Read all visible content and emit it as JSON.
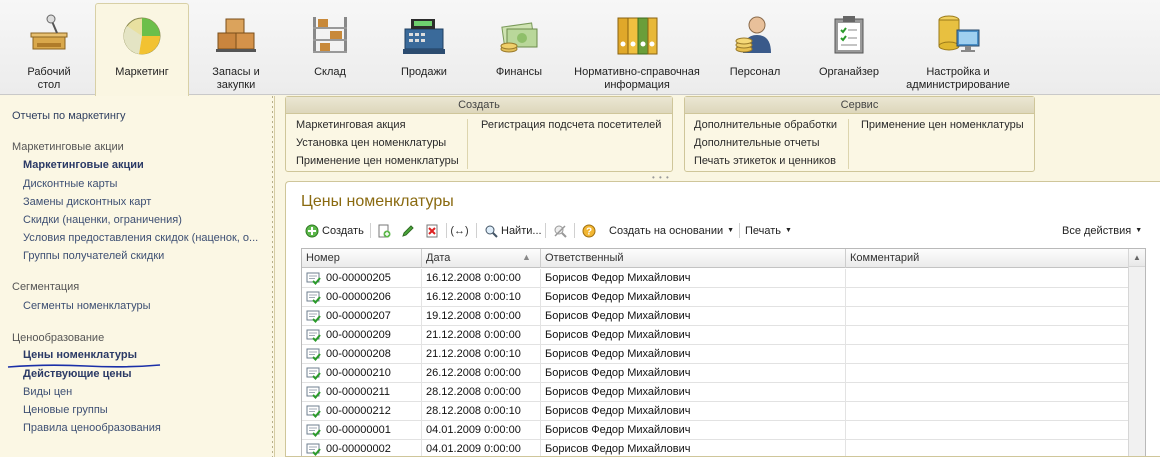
{
  "sections": [
    {
      "label": "Рабочий стол",
      "icon": "desk-icon"
    },
    {
      "label": "Маркетинг",
      "icon": "pie-chart-icon",
      "active": true
    },
    {
      "label": "Запасы и закупки",
      "icon": "boxes-icon"
    },
    {
      "label": "Склад",
      "icon": "warehouse-shelf-icon"
    },
    {
      "label": "Продажи",
      "icon": "cash-register-icon"
    },
    {
      "label": "Финансы",
      "icon": "money-icon"
    },
    {
      "label": "Нормативно-справочная информация",
      "icon": "binders-icon"
    },
    {
      "label": "Персонал",
      "icon": "person-icon"
    },
    {
      "label": "Органайзер",
      "icon": "clipboard-icon"
    },
    {
      "label": "Настройка и администрирование",
      "icon": "database-monitor-icon"
    }
  ],
  "leftnav": {
    "reports": "Отчеты по маркетингу",
    "group1": "Маркетинговые акции",
    "group1_items": [
      "Маркетинговые акции",
      "Дисконтные карты",
      "Замены дисконтных карт",
      "Скидки (наценки, ограничения)",
      "Условия предоставления скидок (наценок, о...",
      "Группы получателей скидки"
    ],
    "group2": "Сегментация",
    "group2_items": [
      "Сегменты номенклатуры"
    ],
    "group3": "Ценообразование",
    "group3_items": [
      "Цены номенклатуры",
      "Действующие цены",
      "Виды цен",
      "Ценовые группы",
      "Правила ценообразования"
    ]
  },
  "create_panel": {
    "title": "Создать",
    "links": [
      "Маркетинговая акция",
      "Установка цен номенклатуры",
      "Применение цен номенклатуры",
      "Регистрация подсчета посетителей"
    ]
  },
  "service_panel": {
    "title": "Сервис",
    "links": [
      "Дополнительные обработки",
      "Дополнительные отчеты",
      "Печать этикеток и ценников",
      "Применение цен номенклатуры"
    ]
  },
  "form": {
    "title": "Цены номенклатуры",
    "toolbar": {
      "create": "Создать",
      "find": "Найти...",
      "create_based": "Создать на основании",
      "print": "Печать",
      "all_actions": "Все действия"
    },
    "columns": [
      "Номер",
      "Дата",
      "Ответственный",
      "Комментарий"
    ],
    "rows": [
      {
        "number": "00-00000205",
        "date": "16.12.2008 0:00:00",
        "responsible": "Борисов Федор Михайлович",
        "comment": ""
      },
      {
        "number": "00-00000206",
        "date": "16.12.2008 0:00:10",
        "responsible": "Борисов Федор Михайлович",
        "comment": ""
      },
      {
        "number": "00-00000207",
        "date": "19.12.2008 0:00:00",
        "responsible": "Борисов Федор Михайлович",
        "comment": ""
      },
      {
        "number": "00-00000209",
        "date": "21.12.2008 0:00:00",
        "responsible": "Борисов Федор Михайлович",
        "comment": ""
      },
      {
        "number": "00-00000208",
        "date": "21.12.2008 0:00:10",
        "responsible": "Борисов Федор Михайлович",
        "comment": ""
      },
      {
        "number": "00-00000210",
        "date": "26.12.2008 0:00:00",
        "responsible": "Борисов Федор Михайлович",
        "comment": ""
      },
      {
        "number": "00-00000211",
        "date": "28.12.2008 0:00:00",
        "responsible": "Борисов Федор Михайлович",
        "comment": ""
      },
      {
        "number": "00-00000212",
        "date": "28.12.2008 0:00:10",
        "responsible": "Борисов Федор Михайлович",
        "comment": ""
      },
      {
        "number": "00-00000001",
        "date": "04.01.2009 0:00:00",
        "responsible": "Борисов Федор Михайлович",
        "comment": ""
      },
      {
        "number": "00-00000002",
        "date": "04.01.2009 0:00:00",
        "responsible": "Борисов Федор Михайлович",
        "comment": ""
      }
    ]
  },
  "colors": {
    "accent_title": "#8a6a10",
    "nav_link": "#3d4f73",
    "underline": "#1a2fa8"
  }
}
